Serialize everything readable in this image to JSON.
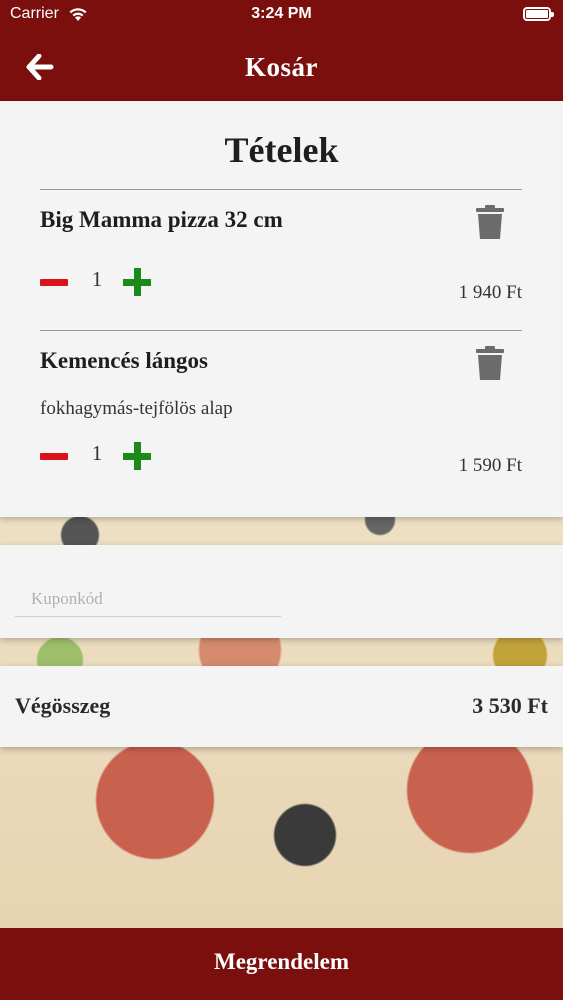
{
  "status_bar": {
    "carrier": "Carrier",
    "time": "3:24 PM"
  },
  "nav": {
    "back_icon": "arrow-left-icon",
    "title": "Kosár"
  },
  "items_section": {
    "title": "Tételek",
    "items": [
      {
        "name": "Big Mamma pizza 32 cm",
        "description": "",
        "quantity": "1",
        "price": "1 940 Ft"
      },
      {
        "name": "Kemencés lángos",
        "description": "fokhagymás-tejfölös alap",
        "quantity": "1",
        "price": "1 590 Ft"
      }
    ]
  },
  "coupon": {
    "placeholder": "Kuponkód",
    "value": ""
  },
  "total": {
    "label": "Végösszeg",
    "value": "3 530 Ft"
  },
  "order_button": {
    "label": "Megrendelem"
  },
  "colors": {
    "brand": "#7a0f0e",
    "minus": "#d8141b",
    "plus": "#1b8a1b",
    "card": "#f4f4f4"
  }
}
